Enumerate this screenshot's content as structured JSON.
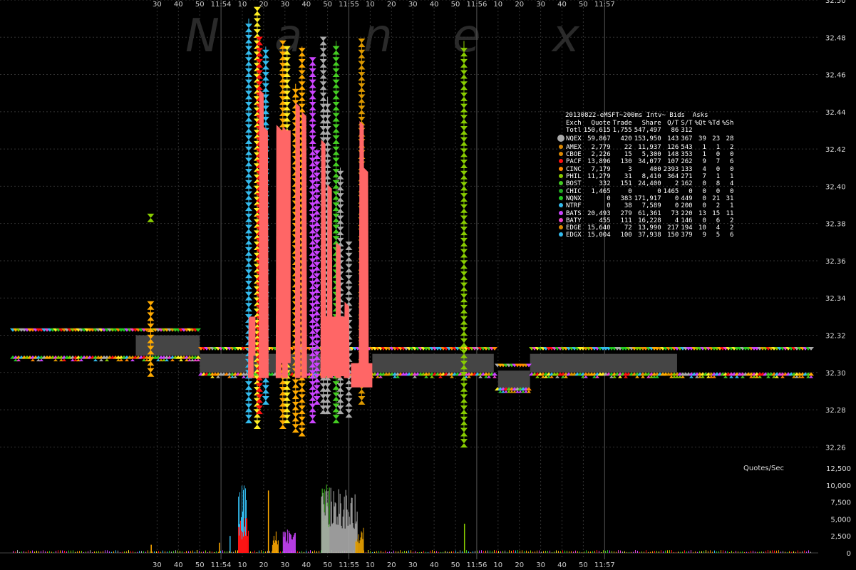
{
  "watermark": [
    "N",
    "a",
    "n",
    "e",
    "x"
  ],
  "chart_data": {
    "type": "scatter",
    "x_tick_labels": [
      "30",
      "40",
      "50",
      "11:54",
      "10",
      "20",
      "30",
      "40",
      "50",
      "11:55",
      "10",
      "20",
      "30",
      "40",
      "50",
      "11:56",
      "10",
      "20",
      "30",
      "40",
      "50",
      "11:57"
    ],
    "x_tick_seconds": [
      -90,
      -80,
      -70,
      -60,
      -50,
      -40,
      -30,
      -20,
      -10,
      0,
      10,
      20,
      30,
      40,
      50,
      60,
      70,
      80,
      90,
      100,
      110,
      120
    ],
    "price_axis": {
      "ticks": [
        "32.26",
        "32.28",
        "32.30",
        "32.32",
        "32.34",
        "32.36",
        "32.38",
        "32.40",
        "32.42",
        "32.44",
        "32.46",
        "32.48",
        "32.50"
      ],
      "range": [
        32.25,
        32.5
      ]
    },
    "volume_axis": {
      "title": "Quotes/Sec",
      "ticks": [
        "0",
        "2,500",
        "5,000",
        "7,500",
        "10,000",
        "12,500"
      ],
      "range": [
        0,
        12500
      ]
    },
    "nbbo_bands": [
      {
        "t0": -100,
        "t1": -70,
        "lo": 32.309,
        "hi": 32.32
      },
      {
        "t0": -70,
        "t1": -47,
        "lo": 32.3,
        "hi": 32.31
      },
      {
        "t0": -47,
        "t1": -34,
        "lo": 32.3,
        "hi": 32.31
      },
      {
        "t0": -30,
        "t1": -25,
        "lo": 32.3,
        "hi": 32.31
      },
      {
        "t0": -23,
        "t1": -16,
        "lo": 32.3,
        "hi": 32.31
      },
      {
        "t0": -16,
        "t1": -1,
        "lo": 32.3,
        "hi": 32.31
      },
      {
        "t0": 11,
        "t1": 68,
        "lo": 32.3,
        "hi": 32.31
      },
      {
        "t0": 70,
        "t1": 85,
        "lo": 32.291,
        "hi": 32.301
      },
      {
        "t0": 85,
        "t1": 154,
        "lo": 32.3,
        "hi": 32.31
      }
    ],
    "spikes": [
      {
        "t": -46,
        "hi": 32.33
      },
      {
        "t": -41,
        "hi": 32.452
      },
      {
        "t": -39,
        "hi": 32.432
      },
      {
        "t": -33,
        "hi": 32.433
      },
      {
        "t": -30,
        "hi": 32.432
      },
      {
        "t": -24,
        "hi": 32.445
      },
      {
        "t": -21,
        "hi": 32.44
      },
      {
        "t": -12,
        "hi": 32.425
      },
      {
        "t": -9,
        "hi": 32.401
      },
      {
        "t": -5,
        "hi": 32.37
      },
      {
        "t": -1,
        "hi": 32.338
      },
      {
        "t": 6,
        "hi": 32.435
      },
      {
        "t": 8,
        "hi": 32.41
      }
    ],
    "quote_bursts": [
      {
        "t0": -52,
        "t1": -48,
        "peak": 10300,
        "color": "#33bbee"
      },
      {
        "t0": -52,
        "t1": -47,
        "peak": 5300,
        "color": "#ff1111"
      },
      {
        "t0": -36,
        "t1": -33,
        "peak": 3300,
        "color": "#ffaa00"
      },
      {
        "t0": -31,
        "t1": -25,
        "peak": 3500,
        "color": "#cc44ff"
      },
      {
        "t0": -13,
        "t1": -9,
        "peak": 10800,
        "color": "#44cc22"
      },
      {
        "t0": -13,
        "t1": 4,
        "peak": 9600,
        "color": "#aaaaaa"
      },
      {
        "t0": 3,
        "t1": 7,
        "peak": 3800,
        "color": "#dd9900"
      }
    ],
    "stats_title": "20130822-eMSFT~200ms Intv~ Bids  Asks",
    "stats_columns": [
      "Exch",
      "Quote",
      "Trade",
      "Share",
      "Q/T",
      "S/T",
      "%Qt",
      "%Td",
      "%Sh"
    ],
    "stats_rows": [
      {
        "name": "Totl",
        "quote": "150,615",
        "trade": "1,755",
        "share": "547,497",
        "qt": "86",
        "st": "312",
        "pqt": "",
        "ptd": "",
        "psh": "",
        "color": ""
      },
      {
        "name": "NQEX",
        "quote": "59,867",
        "trade": "420",
        "share": "153,950",
        "qt": "143",
        "st": "367",
        "pqt": "39",
        "ptd": "23",
        "psh": "28",
        "color": "#aaaaaa"
      },
      {
        "name": "AMEX",
        "quote": "2,779",
        "trade": "22",
        "share": "11,937",
        "qt": "126",
        "st": "543",
        "pqt": "1",
        "ptd": "1",
        "psh": "2",
        "color": "#dd8800"
      },
      {
        "name": "CBOE",
        "quote": "2,226",
        "trade": "15",
        "share": "5,300",
        "qt": "148",
        "st": "353",
        "pqt": "1",
        "ptd": "0",
        "psh": "0",
        "color": "#dd8800"
      },
      {
        "name": "PACF",
        "quote": "13,896",
        "trade": "130",
        "share": "34,077",
        "qt": "107",
        "st": "262",
        "pqt": "9",
        "ptd": "7",
        "psh": "6",
        "color": "#ff1111"
      },
      {
        "name": "CINC",
        "quote": "7,179",
        "trade": "3",
        "share": "400",
        "qt": "2393",
        "st": "133",
        "pqt": "4",
        "ptd": "0",
        "psh": "0",
        "color": "#ff8800"
      },
      {
        "name": "PHIL",
        "quote": "11,279",
        "trade": "31",
        "share": "8,410",
        "qt": "364",
        "st": "271",
        "pqt": "7",
        "ptd": "1",
        "psh": "1",
        "color": "#88cc00"
      },
      {
        "name": "BOST",
        "quote": "332",
        "trade": "151",
        "share": "24,400",
        "qt": "2",
        "st": "162",
        "pqt": "0",
        "ptd": "8",
        "psh": "4",
        "color": "#44cc22"
      },
      {
        "name": "CHIC",
        "quote": "1,465",
        "trade": "0",
        "share": "0",
        "qt": "1465",
        "st": "0",
        "pqt": "0",
        "ptd": "0",
        "psh": "0",
        "color": "#22aa22"
      },
      {
        "name": "NQNX",
        "quote": "0",
        "trade": "383",
        "share": "171,917",
        "qt": "0",
        "st": "449",
        "pqt": "0",
        "ptd": "21",
        "psh": "31",
        "color": "#22cc22"
      },
      {
        "name": "NTRF",
        "quote": "0",
        "trade": "38",
        "share": "7,589",
        "qt": "0",
        "st": "200",
        "pqt": "0",
        "ptd": "2",
        "psh": "1",
        "color": "#33bbee"
      },
      {
        "name": "BATS",
        "quote": "20,493",
        "trade": "279",
        "share": "61,361",
        "qt": "73",
        "st": "220",
        "pqt": "13",
        "ptd": "15",
        "psh": "11",
        "color": "#cc44ff"
      },
      {
        "name": "BATY",
        "quote": "455",
        "trade": "111",
        "share": "16,228",
        "qt": "4",
        "st": "146",
        "pqt": "0",
        "ptd": "6",
        "psh": "2",
        "color": "#ee44cc"
      },
      {
        "name": "EDGE",
        "quote": "15,640",
        "trade": "72",
        "share": "13,990",
        "qt": "217",
        "st": "194",
        "pqt": "10",
        "ptd": "4",
        "psh": "2",
        "color": "#dd8800"
      },
      {
        "name": "EDGX",
        "quote": "15,004",
        "trade": "100",
        "share": "37,938",
        "qt": "150",
        "st": "379",
        "pqt": "9",
        "ptd": "5",
        "psh": "6",
        "color": "#33bbee"
      }
    ]
  }
}
